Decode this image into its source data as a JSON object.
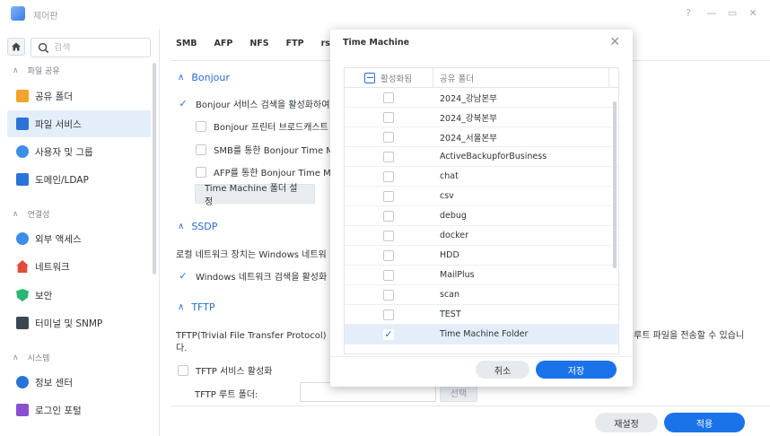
{
  "window": {
    "title": "제어판",
    "controls": [
      "?",
      "—",
      "▭",
      "✕"
    ]
  },
  "sidebar": {
    "search_placeholder": "검색",
    "sections": [
      {
        "label": "파일 공유",
        "items": [
          {
            "label": "공유 폴더",
            "icon": "folder-icon",
            "color": "#f3a32c"
          },
          {
            "label": "파일 서비스",
            "icon": "file-services-icon",
            "color": "#2a74d9",
            "active": true
          },
          {
            "label": "사용자 및 그룹",
            "icon": "users-icon",
            "color": "#3d8ee6"
          },
          {
            "label": "도메인/LDAP",
            "icon": "domain-icon",
            "color": "#2a74d9"
          }
        ]
      },
      {
        "label": "연결성",
        "items": [
          {
            "label": "외부 액세스",
            "icon": "external-access-icon",
            "color": "#3d8ee6"
          },
          {
            "label": "네트워크",
            "icon": "network-icon",
            "color": "#e04c3c"
          },
          {
            "label": "보안",
            "icon": "security-shield-icon",
            "color": "#2bb673"
          },
          {
            "label": "터미널 및 SNMP",
            "icon": "terminal-icon",
            "color": "#3b4653"
          }
        ]
      },
      {
        "label": "시스템",
        "items": [
          {
            "label": "정보 센터",
            "icon": "info-center-icon",
            "color": "#2a74d9"
          },
          {
            "label": "로그인 포털",
            "icon": "login-portal-icon",
            "color": "#8a4fd1"
          }
        ]
      }
    ]
  },
  "main": {
    "tabs": [
      "SMB",
      "AFP",
      "NFS",
      "FTP",
      "rsync"
    ],
    "bonjour": {
      "title": "Bonjour",
      "enable": "Bonjour 서비스 검색을 활성화하여",
      "printer": "Bonjour 프린터 브로드캐스트",
      "smb": "SMB를 통한 Bonjour Time M",
      "afp": "AFP를 통한 Bonjour Time M",
      "tm_button": "Time Machine 폴더 설정"
    },
    "ssdp": {
      "title": "SSDP",
      "desc": "로컬 네트워크 장치는 Windows 네트워",
      "enable": "Windows 네트워크 검색을 활성화"
    },
    "tftp": {
      "title": "TFTP",
      "desc_1": "TFTP(Trivial File Transfer Protocol) 〈",
      "desc_right": "루트 파일을 전송할 수 있습니",
      "desc_2": "다.",
      "enable": "TFTP 서비스 활성화",
      "root_label": "TFTP 루트 폴더:",
      "select_button": "선택"
    },
    "footer": {
      "reset": "재설정",
      "apply": "적용"
    }
  },
  "dialog": {
    "title": "Time Machine",
    "col_enabled": "활성화됨",
    "col_share": "공유 폴더",
    "rows": [
      {
        "name": "2024_강남본부",
        "checked": false
      },
      {
        "name": "2024_강북본부",
        "checked": false
      },
      {
        "name": "2024_서울본부",
        "checked": false
      },
      {
        "name": "ActiveBackupforBusiness",
        "checked": false
      },
      {
        "name": "chat",
        "checked": false
      },
      {
        "name": "csv",
        "checked": false
      },
      {
        "name": "debug",
        "checked": false
      },
      {
        "name": "docker",
        "checked": false
      },
      {
        "name": "HDD",
        "checked": false
      },
      {
        "name": "MailPlus",
        "checked": false
      },
      {
        "name": "scan",
        "checked": false
      },
      {
        "name": "TEST",
        "checked": false
      },
      {
        "name": "Time Machine Folder",
        "checked": true
      }
    ],
    "cancel": "취소",
    "save": "저장"
  }
}
